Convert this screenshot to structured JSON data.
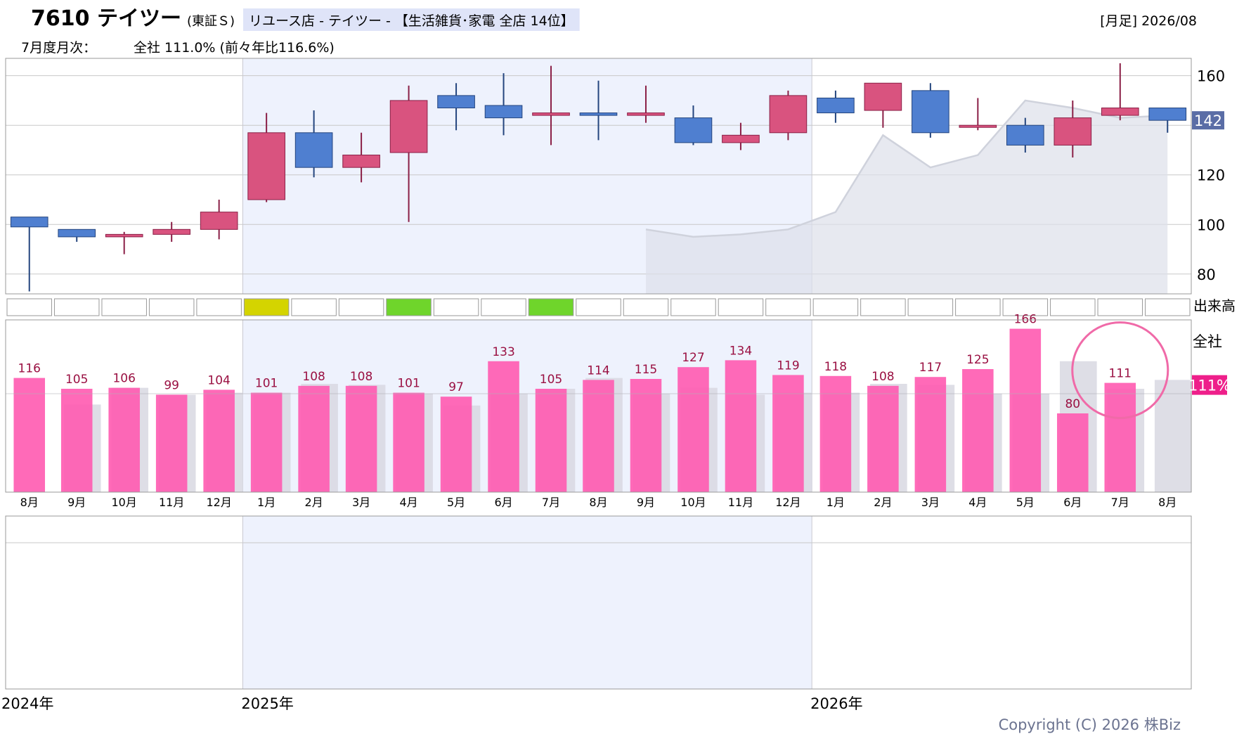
{
  "header": {
    "code_name": "7610 テイツー",
    "market": "(東証Ｓ)",
    "category": "リユース店 - テイツー - 【生活雑貨･家電 全店 14位】",
    "period": "[月足] 2026/08",
    "monthly_prefix": "7月度月次：",
    "monthly_value": "全社 111.0% (前々年比116.6%)"
  },
  "price_panel": {
    "current_label": "142",
    "yticks": [
      80,
      100,
      120,
      140,
      160
    ],
    "ytick_labels": [
      "80",
      "100",
      "120",
      "",
      "160"
    ]
  },
  "volume_label": "出来高",
  "volume_cells": [
    {
      "color": null
    },
    {
      "color": null
    },
    {
      "color": null
    },
    {
      "color": null
    },
    {
      "color": null
    },
    {
      "color": "#d4d400"
    },
    {
      "color": null
    },
    {
      "color": null
    },
    {
      "color": "#6fd52b"
    },
    {
      "color": null
    },
    {
      "color": null
    },
    {
      "color": "#6fd52b"
    },
    {
      "color": null
    },
    {
      "color": null
    },
    {
      "color": null
    },
    {
      "color": null
    },
    {
      "color": null
    },
    {
      "color": null
    },
    {
      "color": null
    },
    {
      "color": null
    },
    {
      "color": null
    },
    {
      "color": null
    },
    {
      "color": null
    },
    {
      "color": null
    },
    {
      "color": null
    }
  ],
  "monthly_panel": {
    "title": "全社",
    "current_badge": "111%"
  },
  "years": [
    "2024年",
    "2025年",
    "2026年"
  ],
  "copyright": "Copyright (C) 2026 株Biz",
  "colors": {
    "up": "#d9537f",
    "down": "#4f7fd0",
    "bar": "#ff5ab0",
    "ghost": "#d8d8e2",
    "highlight": "#eef2fd"
  },
  "chart_data": [
    {
      "type": "candlestick",
      "ylim": [
        72,
        167
      ],
      "months": [
        "8月",
        "9月",
        "10月",
        "11月",
        "12月",
        "1月",
        "2月",
        "3月",
        "4月",
        "5月",
        "6月",
        "7月",
        "8月",
        "9月",
        "10月",
        "11月",
        "12月",
        "1月",
        "2月",
        "3月",
        "4月",
        "5月",
        "6月",
        "7月",
        "8月"
      ],
      "candles": [
        {
          "open": 103,
          "close": 99,
          "high": 103,
          "low": 73
        },
        {
          "open": 98,
          "close": 95,
          "high": 98,
          "low": 93
        },
        {
          "open": 95,
          "close": 96,
          "high": 97,
          "low": 88
        },
        {
          "open": 96,
          "close": 98,
          "high": 101,
          "low": 93
        },
        {
          "open": 98,
          "close": 105,
          "high": 110,
          "low": 94
        },
        {
          "open": 110,
          "close": 137,
          "high": 145,
          "low": 109
        },
        {
          "open": 137,
          "close": 123,
          "high": 146,
          "low": 119
        },
        {
          "open": 123,
          "close": 128,
          "high": 137,
          "low": 117
        },
        {
          "open": 129,
          "close": 150,
          "high": 156,
          "low": 101
        },
        {
          "open": 152,
          "close": 147,
          "high": 157,
          "low": 138
        },
        {
          "open": 148,
          "close": 143,
          "high": 161,
          "low": 136
        },
        {
          "open": 144,
          "close": 145,
          "high": 164,
          "low": 132
        },
        {
          "open": 145,
          "close": 144,
          "high": 158,
          "low": 134
        },
        {
          "open": 144,
          "close": 145,
          "high": 156,
          "low": 141
        },
        {
          "open": 143,
          "close": 133,
          "high": 148,
          "low": 132
        },
        {
          "open": 133,
          "close": 136,
          "high": 141,
          "low": 130
        },
        {
          "open": 137,
          "close": 152,
          "high": 154,
          "low": 134
        },
        {
          "open": 151,
          "close": 145,
          "high": 154,
          "low": 141
        },
        {
          "open": 146,
          "close": 157,
          "high": 157,
          "low": 139
        },
        {
          "open": 154,
          "close": 137,
          "high": 157,
          "low": 135
        },
        {
          "open": 140,
          "close": 140,
          "high": 151,
          "low": 138
        },
        {
          "open": 140,
          "close": 132,
          "high": 143,
          "low": 129
        },
        {
          "open": 132,
          "close": 143,
          "high": 150,
          "low": 127
        },
        {
          "open": 144,
          "close": 147,
          "high": 165,
          "low": 142
        },
        {
          "open": 147,
          "close": 142,
          "high": 147,
          "low": 137
        }
      ],
      "comparison_area": [
        {
          "month_index": 13,
          "value": 98
        },
        {
          "month_index": 14,
          "value": 95
        },
        {
          "month_index": 15,
          "value": 96
        },
        {
          "month_index": 16,
          "value": 98
        },
        {
          "month_index": 17,
          "value": 105
        },
        {
          "month_index": 18,
          "value": 136
        },
        {
          "month_index": 19,
          "value": 123
        },
        {
          "month_index": 20,
          "value": 128
        },
        {
          "month_index": 21,
          "value": 150
        },
        {
          "month_index": 22,
          "value": 147
        },
        {
          "month_index": 23,
          "value": 143
        },
        {
          "month_index": 24,
          "value": 144
        }
      ]
    },
    {
      "type": "bar",
      "ylim": [
        0,
        175
      ],
      "categories": [
        "8月",
        "9月",
        "10月",
        "11月",
        "12月",
        "1月",
        "2月",
        "3月",
        "4月",
        "5月",
        "6月",
        "7月",
        "8月",
        "9月",
        "10月",
        "11月",
        "12月",
        "1月",
        "2月",
        "3月",
        "4月",
        "5月",
        "6月",
        "7月",
        "8月"
      ],
      "series": [
        {
          "values": [
            116,
            105,
            106,
            99,
            104,
            101,
            108,
            108,
            101,
            97,
            133,
            105,
            114,
            115,
            127,
            134,
            119,
            118,
            108,
            117,
            125,
            166,
            80,
            111,
            null
          ]
        },
        {
          "values": [
            null,
            89,
            106,
            99,
            101,
            101,
            110,
            109,
            100,
            88,
            100,
            105,
            116,
            100,
            106,
            99,
            101,
            101,
            110,
            109,
            100,
            100,
            133,
            105,
            114
          ]
        }
      ],
      "data_labels": [
        "116",
        "105",
        "106",
        "99",
        "104",
        "101",
        "108",
        "108",
        "101",
        "97",
        "133",
        "105",
        "114",
        "115",
        "127",
        "134",
        "119",
        "118",
        "108",
        "117",
        "125",
        "166",
        "80",
        "111",
        ""
      ],
      "reference_line": 100,
      "highlight_index": 23
    }
  ]
}
